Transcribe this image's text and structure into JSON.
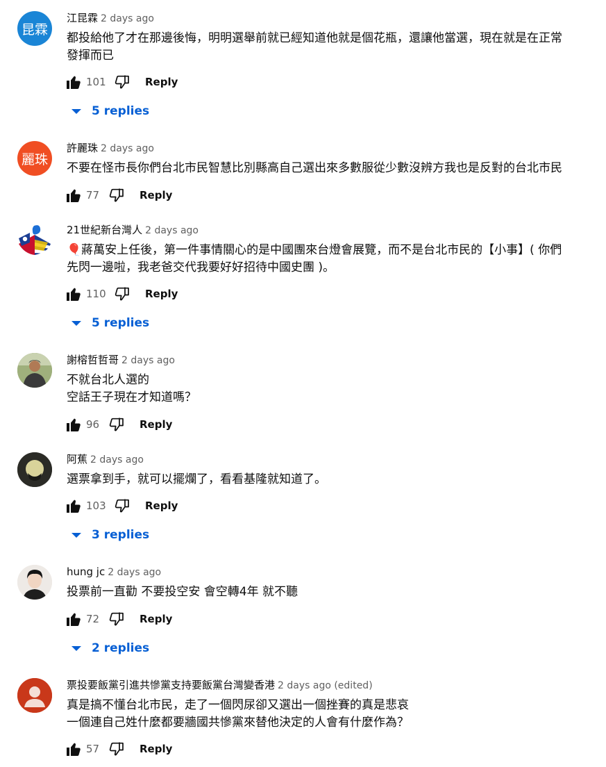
{
  "labels": {
    "reply": "Reply"
  },
  "comments": [
    {
      "avatar_text": "昆霖",
      "avatar_color": "#1a85d6",
      "author": "江昆霖",
      "time": "2 days ago",
      "text": "都投給他了才在那邊後悔，明明選舉前就已經知道他就是個花瓶，還讓他當選，現在就是在正常\n發揮而已",
      "likes": "101",
      "replies": "5 replies"
    },
    {
      "avatar_text": "麗珠",
      "avatar_color": "#f04e23",
      "author": "許麗珠",
      "time": "2 days ago",
      "text": "不要在怪市長你們台北市民智慧比別縣高自己選出來多數服從少數沒辨方我也是反對的台北市民",
      "likes": "77"
    },
    {
      "avatar_text": "",
      "avatar_color": "#ffffff",
      "author": "21世紀新台灣人",
      "time": "2 days ago",
      "text": "🎈蔣萬安上任後，第一件事情關心的是中國團來台燈會展覽，而不是台北市民的【小事】( 你們\n先閃一邊啦，我老爸交代我要好好招待中國史團 )。",
      "likes": "110",
      "replies": "5 replies"
    },
    {
      "avatar_text": "",
      "avatar_color": "#8a9a6c",
      "author": "謝榕哲哲哥",
      "time": "2 days ago",
      "text": "不就台北人選的\n空話王子現在才知道嗎？",
      "likes": "96"
    },
    {
      "avatar_text": "",
      "avatar_color": "#3a3a32",
      "author": "阿蕉",
      "time": "2 days ago",
      "text": "選票拿到手，就可以擺爛了，看看基隆就知道了。",
      "likes": "103",
      "replies": "3 replies"
    },
    {
      "avatar_text": "",
      "avatar_color": "#e8e4df",
      "author": "hung jc",
      "time": "2 days ago",
      "text": "投票前一直勸 不要投空安 會空轉4年 就不聽",
      "likes": "72",
      "replies": "2 replies"
    },
    {
      "avatar_text": "",
      "avatar_color": "#c9381a",
      "author": "票投要飯黨引進共慘黨支持要飯黨台灣變香港",
      "time": "2 days ago (edited)",
      "text": "真是搞不懂台北市民，走了一個閃尿卻又選出一個挫賽的真是悲哀\n一個連自己姓什麼都要牆國共慘黨來替他決定的人會有什麼作為？",
      "likes": "57"
    }
  ]
}
